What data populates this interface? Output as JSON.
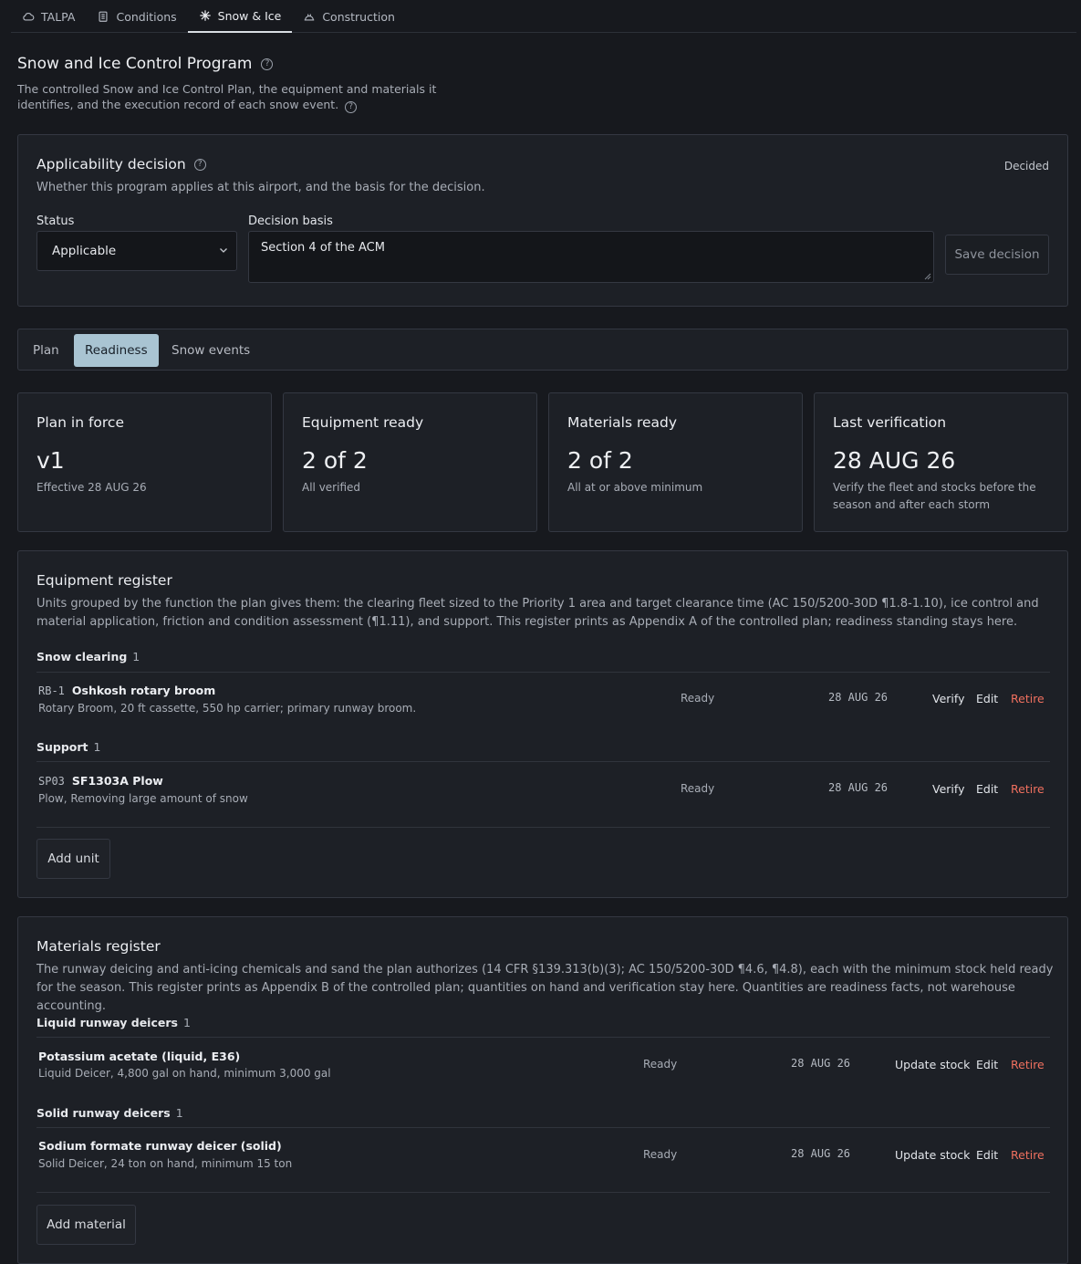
{
  "nav": {
    "tabs": [
      {
        "label": "TALPA",
        "icon": "cloud-icon"
      },
      {
        "label": "Conditions",
        "icon": "clipboard-icon"
      },
      {
        "label": "Snow & Ice",
        "icon": "snowflake-icon"
      },
      {
        "label": "Construction",
        "icon": "hardhat-icon"
      }
    ],
    "active": "Snow & Ice"
  },
  "header": {
    "title": "Snow and Ice Control Program",
    "subtitle": "The controlled Snow and Ice Control Plan, the equipment and materials it identifies, and the execution record of each snow event."
  },
  "applicability": {
    "title": "Applicability decision",
    "subtitle": "Whether this program applies at this airport, and the basis for the decision.",
    "state": "Decided",
    "status_label": "Status",
    "status_value": "Applicable",
    "basis_label": "Decision basis",
    "basis_value": "Section 4 of the ACM",
    "save_label": "Save decision"
  },
  "subtabs": [
    {
      "label": "Plan"
    },
    {
      "label": "Readiness"
    },
    {
      "label": "Snow events"
    }
  ],
  "subtab_active": "Readiness",
  "stats": [
    {
      "title": "Plan in force",
      "value": "v1",
      "desc": "Effective 28 AUG 26"
    },
    {
      "title": "Equipment ready",
      "value": "2 of 2",
      "desc": "All verified"
    },
    {
      "title": "Materials ready",
      "value": "2 of 2",
      "desc": "All at or above minimum"
    },
    {
      "title": "Last verification",
      "value": "28 AUG 26",
      "desc": "Verify the fleet and stocks before the season and after each storm"
    }
  ],
  "equipment": {
    "title": "Equipment register",
    "desc": "Units grouped by the function the plan gives them: the clearing fleet sized to the Priority 1 area and target clearance time (AC 150/5200-30D ¶1.8-1.10), ice control and material application, friction and condition assessment (¶1.11), and support. This register prints as Appendix A of the controlled plan; readiness standing stays here.",
    "groups": [
      {
        "name": "Snow clearing",
        "count": "1",
        "item": {
          "code": "RB-1",
          "name": "Oshkosh rotary broom",
          "desc": "Rotary Broom, 20 ft cassette, 550 hp carrier; primary runway broom.",
          "status": "Ready",
          "date": "28 AUG 26",
          "a1": "Verify",
          "a2": "Edit",
          "a3": "Retire"
        }
      },
      {
        "name": "Support",
        "count": "1",
        "item": {
          "code": "SP03",
          "name": "SF1303A Plow",
          "desc": "Plow, Removing large amount of snow",
          "status": "Ready",
          "date": "28 AUG 26",
          "a1": "Verify",
          "a2": "Edit",
          "a3": "Retire"
        }
      }
    ],
    "add_label": "Add unit"
  },
  "materials": {
    "title": "Materials register",
    "desc": "The runway deicing and anti-icing chemicals and sand the plan authorizes (14 CFR §139.313(b)(3); AC 150/5200-30D ¶4.6, ¶4.8), each with the minimum stock held ready for the season. This register prints as Appendix B of the controlled plan; quantities on hand and verification stay here. Quantities are readiness facts, not warehouse accounting.",
    "groups": [
      {
        "name": "Liquid runway deicers",
        "count": "1",
        "item": {
          "name": "Potassium acetate (liquid, E36)",
          "desc": "Liquid Deicer, 4,800 gal on hand, minimum 3,000 gal",
          "status": "Ready",
          "date": "28 AUG 26",
          "a1": "Update stock",
          "a2": "Edit",
          "a3": "Retire"
        }
      },
      {
        "name": "Solid runway deicers",
        "count": "1",
        "item": {
          "name": "Sodium formate runway deicer (solid)",
          "desc": "Solid Deicer, 24 ton on hand, minimum 15 ton",
          "status": "Ready",
          "date": "28 AUG 26",
          "a1": "Update stock",
          "a2": "Edit",
          "a3": "Retire"
        }
      }
    ],
    "add_label": "Add material"
  },
  "colors": {
    "accent": "#a9c4d2",
    "danger": "#f0705f",
    "bg": "#17191e"
  }
}
